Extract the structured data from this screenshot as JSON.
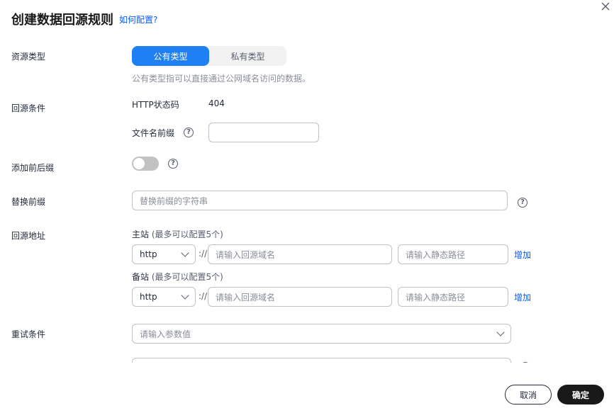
{
  "dialog": {
    "title": "创建数据回源规则",
    "help_link": "如何配置?"
  },
  "resource_type": {
    "label": "资源类型",
    "options": [
      "公有类型",
      "私有类型"
    ],
    "selected": "公有类型",
    "hint": "公有类型指可以直接通过公网域名访问的数据。"
  },
  "source_condition": {
    "label": "回源条件",
    "http_status_label": "HTTP状态码",
    "http_status_value": "404",
    "filename_prefix_label": "文件名前缀",
    "filename_prefix_value": ""
  },
  "add_affix": {
    "label": "添加前后缀",
    "enabled": false
  },
  "replace_prefix": {
    "label": "替换前缀",
    "placeholder": "替换前缀的字符串"
  },
  "source_address": {
    "label": "回源地址",
    "primary": {
      "title": "主站",
      "note": "(最多可以配置5个)",
      "protocol": "http",
      "separator": "://",
      "domain_placeholder": "请输入回源域名",
      "path_placeholder": "请输入静态路径",
      "add_label": "增加"
    },
    "backup": {
      "title": "备站",
      "note": "(最多可以配置5个)",
      "protocol": "http",
      "separator": "://",
      "domain_placeholder": "请输入回源域名",
      "path_placeholder": "请输入静态路径",
      "add_label": "增加"
    }
  },
  "retry_condition": {
    "label": "重试条件",
    "placeholder": "请输入参数值"
  },
  "footer": {
    "cancel_label": "取消",
    "ok_label": "确定"
  },
  "colors": {
    "primary": "#1f7ff5",
    "link": "#0a59f7",
    "ok_button": "#191919"
  }
}
